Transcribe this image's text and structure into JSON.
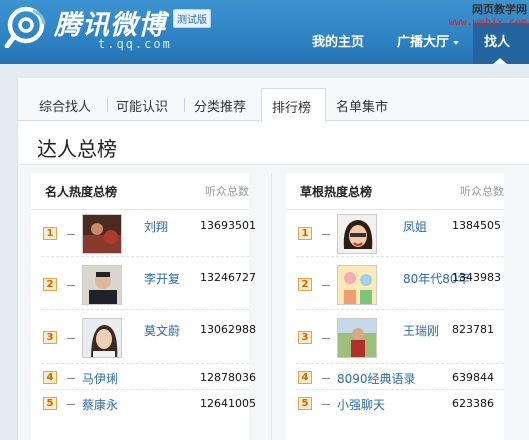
{
  "header": {
    "logo_text": "腾讯微博",
    "beta_label": "测试版",
    "url": "t.qq.com",
    "nav": [
      {
        "label": "我的主页"
      },
      {
        "label": "广播大厅"
      },
      {
        "label": "找人"
      }
    ],
    "watermark_line1": "网页教学网",
    "watermark_line2": "www.webjx.com"
  },
  "tabs": [
    "综合找人",
    "可能认识",
    "分类推荐",
    "排行榜",
    "名单集市"
  ],
  "active_tab_index": 3,
  "page_title": "达人总榜",
  "left_column": {
    "title": "名人热度总榜",
    "sub_label": "听众总数",
    "rows": [
      {
        "rank": "1",
        "name": "刘翔",
        "count": "13693501",
        "avatar": "avatar-1"
      },
      {
        "rank": "2",
        "name": "李开复",
        "count": "13246727",
        "avatar": "avatar-2"
      },
      {
        "rank": "3",
        "name": "莫文蔚",
        "count": "13062988",
        "avatar": "avatar-3"
      },
      {
        "rank": "4",
        "name": "马伊琍",
        "count": "12878036"
      },
      {
        "rank": "5",
        "name": "蔡康永",
        "count": "12641005"
      }
    ]
  },
  "right_column": {
    "title": "草根热度总榜",
    "sub_label": "听众总数",
    "rows": [
      {
        "rank": "1",
        "name": "凤姐",
        "count": "1384505",
        "avatar": "avatar-1"
      },
      {
        "rank": "2",
        "name": "80年代80年",
        "count": "1343983",
        "avatar": "avatar-2"
      },
      {
        "rank": "3",
        "name": "王瑞刚",
        "count": "823781",
        "avatar": "avatar-3"
      },
      {
        "rank": "4",
        "name": "8090经典语录",
        "count": "639844"
      },
      {
        "rank": "5",
        "name": "小强聊天",
        "count": "623386"
      }
    ]
  },
  "colors": {
    "header_blue": "#2c7fc0",
    "link_blue": "#2b6aa6",
    "rank_orange": "#e8a24a"
  }
}
